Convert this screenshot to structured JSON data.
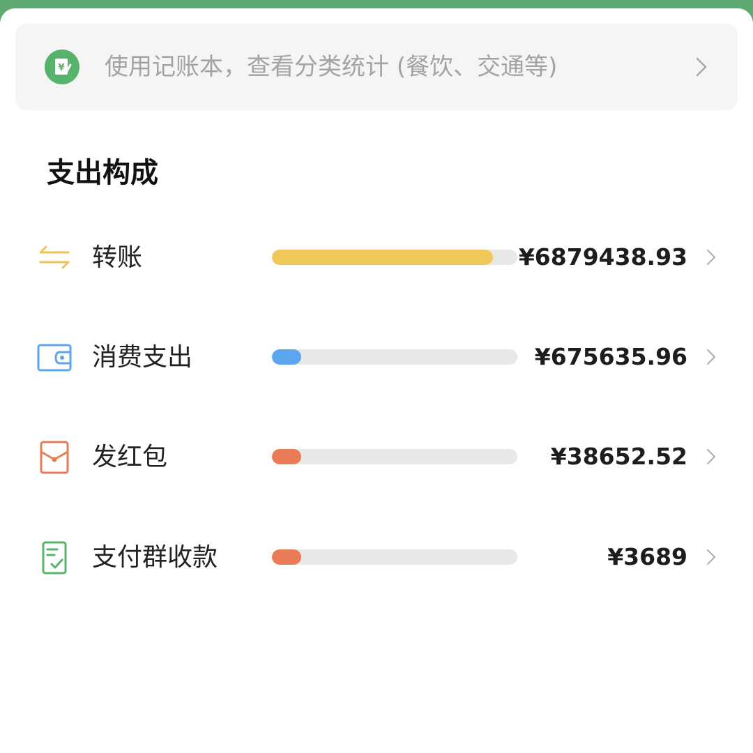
{
  "banner": {
    "icon": "ledger-yuan-icon",
    "text": "使用记账本，查看分类统计 (餐饮、交通等)"
  },
  "section_title": "支出构成",
  "categories": [
    {
      "label": "转账",
      "amount": "¥6879438.93",
      "share": 0.9,
      "color": "#f1c95a",
      "icon": "transfer-arrows-icon"
    },
    {
      "label": "消费支出",
      "amount": "¥675635.96",
      "share": 0.12,
      "color": "#5ca5ef",
      "icon": "wallet-icon"
    },
    {
      "label": "发红包",
      "amount": "¥38652.52",
      "share": 0.12,
      "color": "#e97b57",
      "icon": "red-envelope-icon"
    },
    {
      "label": "支付群收款",
      "amount": "¥3689",
      "share": 0.12,
      "color": "#e97b57",
      "icon": "receipt-check-icon"
    }
  ]
}
